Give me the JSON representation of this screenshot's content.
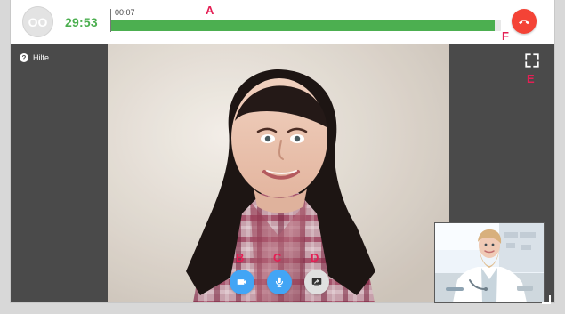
{
  "call": {
    "avatar_initials": "OO",
    "remaining_time": "29:53",
    "elapsed_time": "00:07",
    "progress_percent": 98.4,
    "help_label": "Hilfe"
  },
  "annotations": {
    "a": "A",
    "b": "B",
    "c": "C",
    "d": "D",
    "e": "E",
    "f": "F"
  },
  "icons": {
    "help": "help-circle-icon",
    "camera": "video-camera-icon",
    "mic": "microphone-icon",
    "screen_share": "screen-share-icon",
    "fullscreen": "fullscreen-icon",
    "end_call": "end-call-icon"
  },
  "colors": {
    "progress": "#4caf50",
    "end_call": "#f44336",
    "annotation": "#e41f54",
    "camera_button": "#42a5f5",
    "mic_button": "#42a5f5",
    "share_button": "#e0e0e0"
  }
}
